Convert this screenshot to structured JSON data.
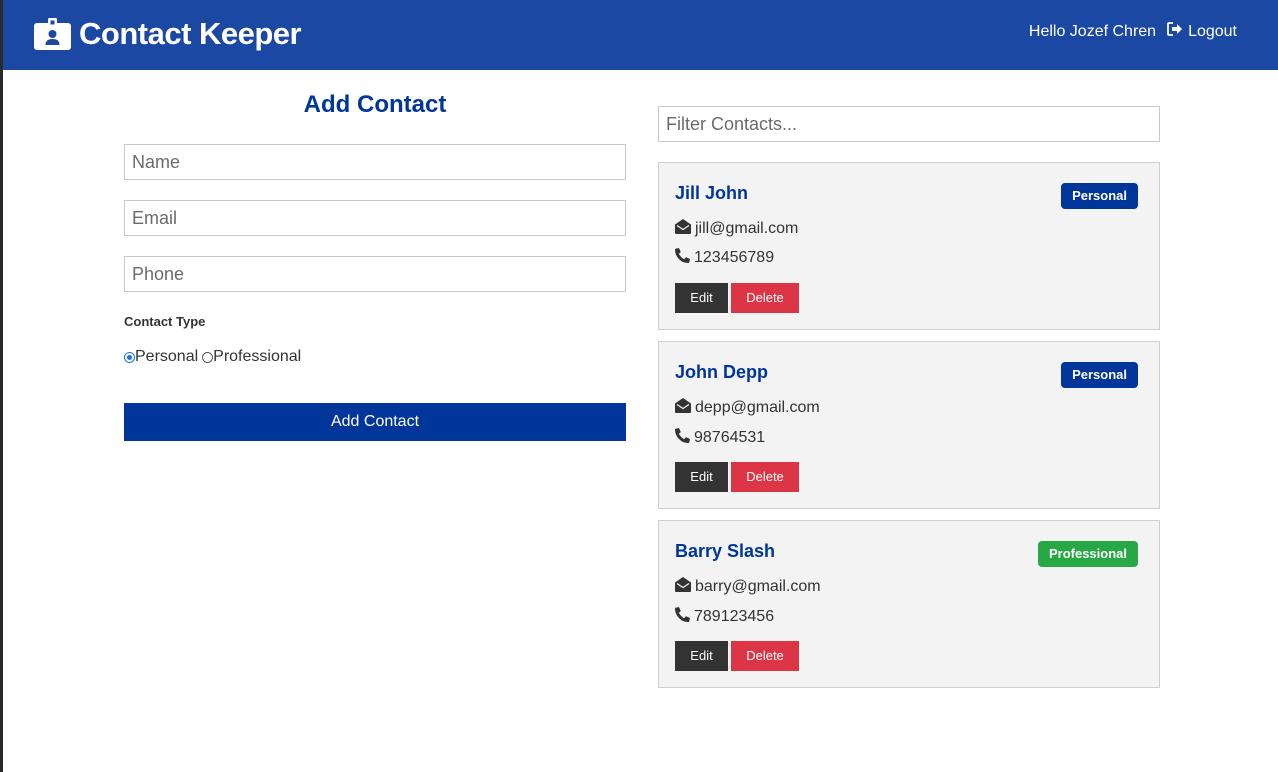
{
  "navbar": {
    "title": "Contact Keeper",
    "greeting": "Hello Jozef Chren",
    "logout_label": "Logout"
  },
  "form": {
    "title": "Add Contact",
    "name_placeholder": "Name",
    "email_placeholder": "Email",
    "phone_placeholder": "Phone",
    "contact_type_label": "Contact Type",
    "options": [
      {
        "label": "Personal",
        "selected": true
      },
      {
        "label": "Professional",
        "selected": false
      }
    ],
    "submit_label": "Add Contact"
  },
  "filter": {
    "placeholder": "Filter Contacts..."
  },
  "contacts": [
    {
      "name": "Jill John",
      "type": "Personal",
      "email": "jill@gmail.com",
      "phone": "123456789",
      "edit_label": "Edit",
      "delete_label": "Delete"
    },
    {
      "name": "John Depp",
      "type": "Personal",
      "email": "depp@gmail.com",
      "phone": "98764531",
      "edit_label": "Edit",
      "delete_label": "Delete"
    },
    {
      "name": "Barry Slash",
      "type": "Professional",
      "email": "barry@gmail.com",
      "phone": "789123456",
      "edit_label": "Edit",
      "delete_label": "Delete"
    }
  ],
  "colors": {
    "navbar": "#1b48a3",
    "primary": "#003699",
    "personal_badge": "#003699",
    "professional_badge": "#28a745",
    "edit_button": "#333333",
    "delete_button": "#dc3545"
  }
}
